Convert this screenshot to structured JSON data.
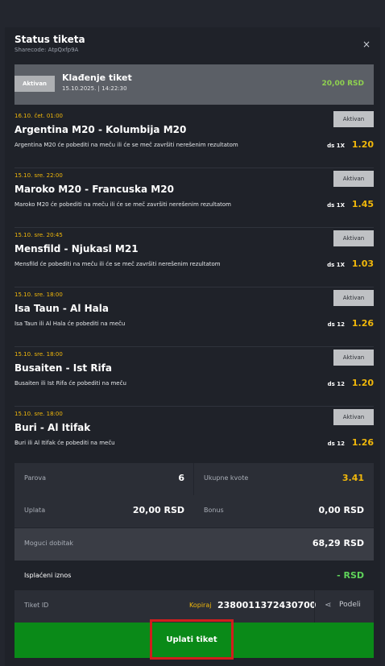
{
  "header": {
    "title": "Status tiketa",
    "sharecode": "Sharecode: AtpQxfp9A",
    "close": "×"
  },
  "summary": {
    "badge": "Aktivan",
    "title": "Klađenje tiket",
    "date": "15.10.2025. | 14:22:30",
    "amount": "20,00 RSD"
  },
  "matches": [
    {
      "time": "16.10. čet. 01:00",
      "name": "Argentina M20 - Kolumbija M20",
      "desc": "Argentina M20 će pobediti na meču ili će se meč završiti nerešenim rezultatom",
      "status": "Aktivan",
      "bet": "ds 1X",
      "odds": "1.20"
    },
    {
      "time": "15.10. sre. 22:00",
      "name": "Maroko M20 - Francuska M20",
      "desc": "Maroko M20 će pobediti na meču ili će se meč završiti nerešenim rezultatom",
      "status": "Aktivan",
      "bet": "ds 1X",
      "odds": "1.45"
    },
    {
      "time": "15.10. sre. 20:45",
      "name": "Mensfild - Njukasl M21",
      "desc": "Mensfild će pobediti na meču ili će se meč završiti nerešenim rezultatom",
      "status": "Aktivan",
      "bet": "ds 1X",
      "odds": "1.03"
    },
    {
      "time": "15.10. sre. 18:00",
      "name": "Isa Taun - Al Hala",
      "desc": "Isa Taun ili Al Hala će pobediti na meču",
      "status": "Aktivan",
      "bet": "ds 12",
      "odds": "1.26"
    },
    {
      "time": "15.10. sre. 18:00",
      "name": "Busaiten - Ist Rifa",
      "desc": "Busaiten ili Ist Rifa će pobediti na meču",
      "status": "Aktivan",
      "bet": "ds 12",
      "odds": "1.20"
    },
    {
      "time": "15.10. sre. 18:00",
      "name": "Buri - Al Itifak",
      "desc": "Buri ili Al Itifak će pobediti na meču",
      "status": "Aktivan",
      "bet": "ds 12",
      "odds": "1.26"
    }
  ],
  "stats": {
    "pairs_label": "Parova",
    "pairs_value": "6",
    "total_odds_label": "Ukupne kvote",
    "total_odds_value": "3.41",
    "stake_label": "Uplata",
    "stake_value": "20,00 RSD",
    "bonus_label": "Bonus",
    "bonus_value": "0,00 RSD",
    "win_label": "Moguci dobitak",
    "win_value": "68,29 RSD",
    "paid_label": "Isplaćeni iznos",
    "paid_value": "- RSD"
  },
  "ticket": {
    "id_label": "Tiket ID",
    "copy_label": "Kopiraj",
    "id_value": "2380011372430700",
    "share_icon": "share-icon",
    "share_label": "Podeli"
  },
  "pay": {
    "label": "Uplati tiket"
  },
  "colors": {
    "accent": "#f1b80b",
    "green": "#0a8a18",
    "positive": "#8fd14f",
    "highlight": "#d21d1d"
  }
}
